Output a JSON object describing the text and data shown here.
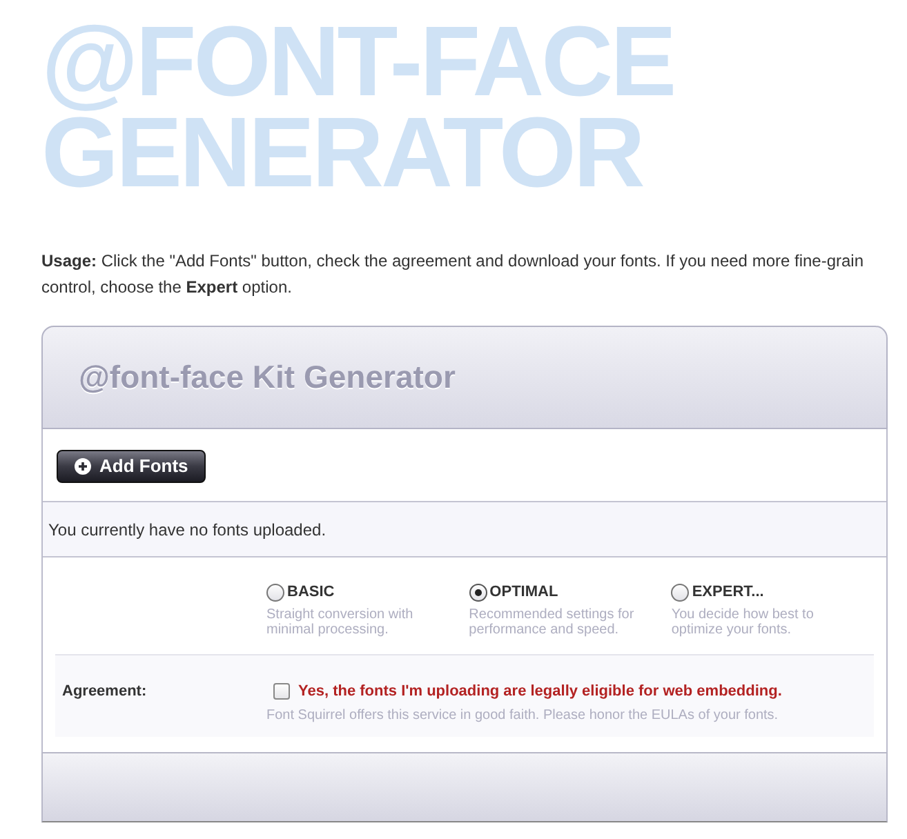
{
  "heading": "@FONT-FACE GENERATOR",
  "usage": "**Usage:** Click the \"Add Fonts\" button, check the agreement and download your fonts. If you need more fine-grain control, choose the **Expert** option.",
  "panel": {
    "title": "@font-face Kit Generator",
    "add_button": "Add Fonts",
    "status": "You currently have no fonts uploaded.",
    "modes": [
      {
        "label": "BASIC",
        "description": "Straight conversion with minimal processing.",
        "selected": false
      },
      {
        "label": "OPTIMAL",
        "description": "Recommended settings for performance and speed.",
        "selected": true
      },
      {
        "label": "EXPERT...",
        "description": "You decide how best to optimize your fonts.",
        "selected": false
      }
    ],
    "agreement": {
      "label": "Agreement:",
      "checkbox": {
        "label": "Yes, the fonts I'm uploading are legally eligible for web embedding.",
        "checked": false
      },
      "note": "Font Squirrel offers this service in good faith. Please honor the EULAs of your fonts."
    }
  }
}
